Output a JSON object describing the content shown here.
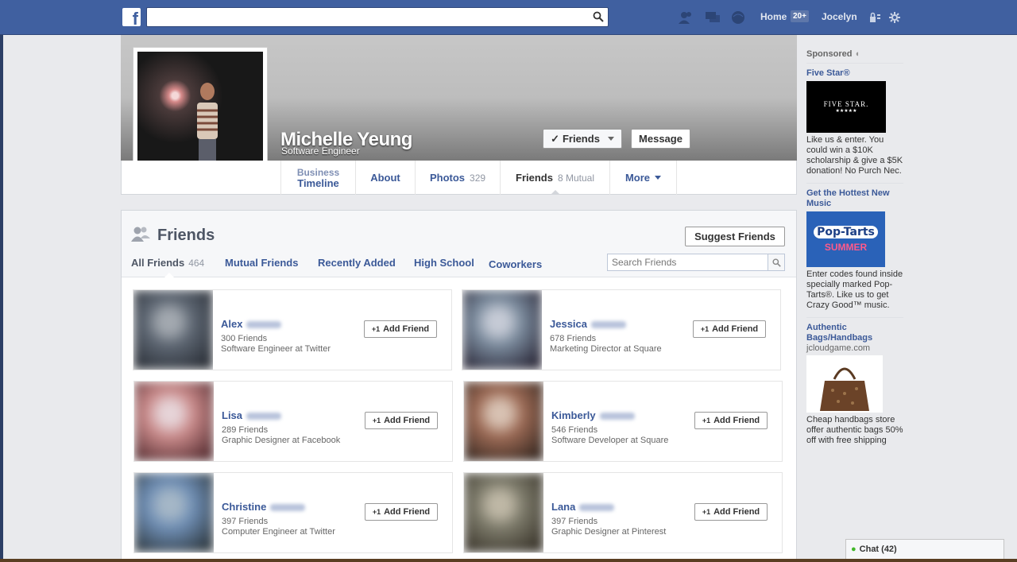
{
  "topbar": {
    "home_label": "Home",
    "home_badge": "20+",
    "user_name": "Jocelyn",
    "search_placeholder": ""
  },
  "profile": {
    "name": "Michelle Yeung",
    "subtitle": "Software Engineer",
    "friends_button": "Friends",
    "message_button": "Message"
  },
  "profile_nav": {
    "timeline_top": "Business",
    "timeline_label": "Timeline",
    "about": "About",
    "photos": "Photos",
    "photos_count": "329",
    "friends": "Friends",
    "friends_count": "8 Mutual",
    "more": "More"
  },
  "friends_panel": {
    "title": "Friends",
    "suggest_button": "Suggest Friends",
    "search_placeholder": "Search Friends",
    "tabs": [
      {
        "label": "All Friends",
        "count": "464"
      },
      {
        "label": "Mutual Friends"
      },
      {
        "label": "Recently Added"
      },
      {
        "label": "High School"
      },
      {
        "label": "Coworkers"
      }
    ],
    "add_friend_label": "Add Friend",
    "friends": [
      {
        "first": "Alex",
        "count": "300 Friends",
        "work": "Software Engineer at Twitter",
        "thumb_colors": [
          "#5d6672",
          "#2b3038",
          "#a3a9b0"
        ]
      },
      {
        "first": "Jessica",
        "count": "678 Friends",
        "work": "Marketing Director at Square",
        "thumb_colors": [
          "#7a8a9c",
          "#2c2a3a",
          "#c6cbd6"
        ]
      },
      {
        "first": "Lisa",
        "count": "289 Friends",
        "work": "Graphic Designer at Facebook",
        "thumb_colors": [
          "#c98a8a",
          "#5a3034",
          "#e6d4d8"
        ]
      },
      {
        "first": "Kimberly",
        "count": "546 Friends",
        "work": "Software Developer at Square",
        "thumb_colors": [
          "#9c6a55",
          "#3a2a22",
          "#d8c2b3"
        ]
      },
      {
        "first": "Christine",
        "count": "397 Friends",
        "work": "Computer Engineer at Twitter",
        "thumb_colors": [
          "#6e8db3",
          "#2f3a42",
          "#a5b7c7"
        ]
      },
      {
        "first": "Lana",
        "count": "397 Friends",
        "work": "Graphic Designer at Pinterest",
        "thumb_colors": [
          "#7c7a6a",
          "#3b362c",
          "#bfb8a6"
        ]
      }
    ]
  },
  "ads": {
    "sponsored_label": "Sponsored",
    "items": [
      {
        "title": "Five Star®",
        "image_text": "FIVE STAR.",
        "text": "Like us & enter. You could win a $10K scholarship & give a $5K donation! No Purch Nec."
      },
      {
        "title": "Get the Hottest New Music",
        "image_text": "Pop-Tarts",
        "image_sub": "SUMMER",
        "text": "Enter codes found inside specially marked Pop-Tarts®. Like us to get Crazy Good™ music."
      },
      {
        "title": "Authentic Bags/Handbags",
        "url": "jcloudgame.com",
        "text": "Cheap handbags store offer authentic bags 50% off with free shipping"
      }
    ]
  },
  "chat": {
    "label": "Chat (42)"
  },
  "colors": {
    "brand": "#4060a0",
    "link": "#3b5998"
  }
}
